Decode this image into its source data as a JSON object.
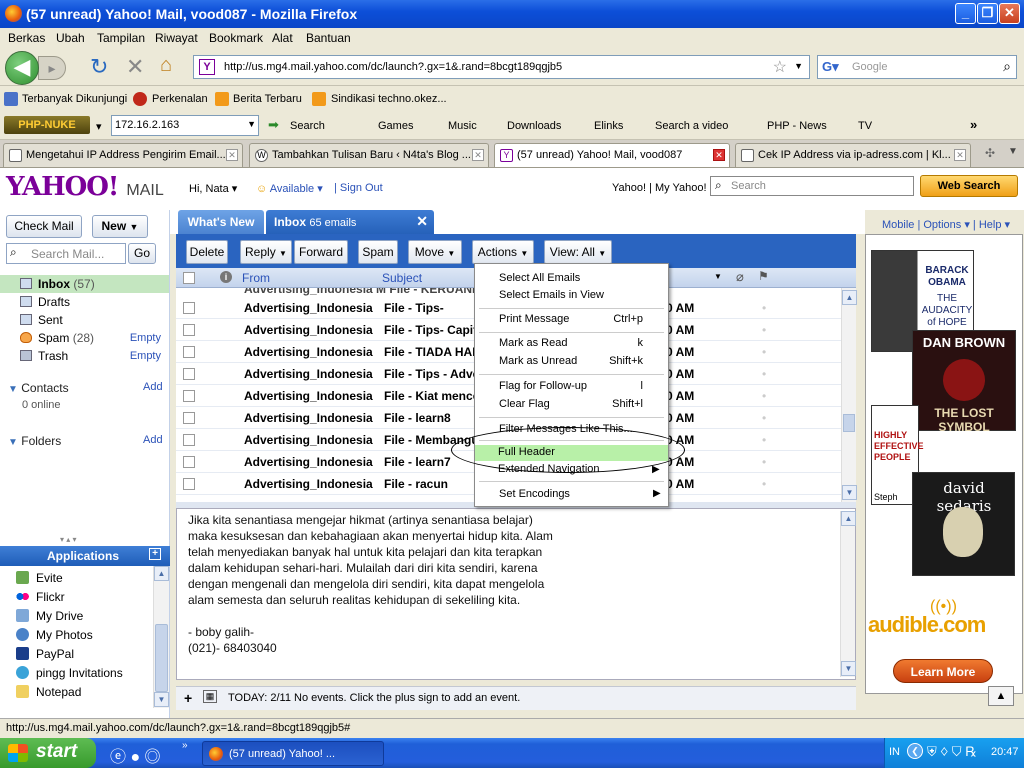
{
  "window": {
    "title": "(57 unread) Yahoo! Mail, vood087 - Mozilla Firefox"
  },
  "menubar": [
    "Berkas",
    "Ubah",
    "Tampilan",
    "Riwayat",
    "Bookmark",
    "Alat",
    "Bantuan"
  ],
  "nav": {
    "url": "http://us.mg4.mail.yahoo.com/dc/launch?.gx=1&.rand=8bcgt189qgjb5",
    "search_placeholder": "Google"
  },
  "bookmarks": [
    "Terbanyak Dikunjungi",
    "Perkenalan",
    "Berita Terbaru",
    "Sindikasi techno.okez..."
  ],
  "toolbar2": {
    "brand": "PHP-NUKE",
    "ip": "172.16.2.163",
    "items": [
      "Search",
      "Games",
      "Music",
      "Downloads",
      "Elinks",
      "Search a video",
      "PHP - News",
      "TV"
    ],
    "more": "»"
  },
  "tabs": [
    {
      "label": "Mengetahui IP Address Pengirim Email..."
    },
    {
      "label": "Tambahkan Tulisan Baru ‹ N4ta's Blog ..."
    },
    {
      "label": "(57 unread) Yahoo! Mail, vood087"
    },
    {
      "label": "Cek IP Address via ip-adress.com | Kl..."
    }
  ],
  "yahoo": {
    "logo": "YAHOO!",
    "logo_suffix": "MAIL",
    "greeting": "Hi, Nata",
    "status": "Available",
    "signout": "Sign Out",
    "links": "Yahoo! | My Yahoo!",
    "search_placeholder": "Search",
    "websearch": "Web Search",
    "toplinks": "Mobile | Options ▾ | Help ▾"
  },
  "sidebar": {
    "check_mail": "Check Mail",
    "new": "New",
    "search_placeholder": "Search Mail...",
    "go": "Go",
    "folders": [
      {
        "name": "Inbox",
        "count": "(57)",
        "empty": ""
      },
      {
        "name": "Drafts",
        "count": "",
        "empty": ""
      },
      {
        "name": "Sent",
        "count": "",
        "empty": ""
      },
      {
        "name": "Spam",
        "count": "(28)",
        "empty": "Empty"
      },
      {
        "name": "Trash",
        "count": "",
        "empty": "Empty"
      }
    ],
    "contacts": "Contacts",
    "contacts_add": "Add",
    "contacts_online": "0 online",
    "folders_label": "Folders",
    "folders_add": "Add",
    "applications": "Applications",
    "apps": [
      "Evite",
      "Flickr",
      "My Drive",
      "My Photos",
      "PayPal",
      "pingg Invitations",
      "Notepad"
    ]
  },
  "main": {
    "tab_whatsnew": "What's New",
    "tab_inbox": "Inbox",
    "inbox_count": "65 emails",
    "buttons": [
      "Delete",
      "Reply",
      "Forward",
      "Spam",
      "Move",
      "Actions",
      "View: All"
    ],
    "col_from": "From",
    "col_subject": "Subject",
    "rows": [
      {
        "from": "Advertising_Indonesia M",
        "subject": "File - Tips-",
        "time": "0 AM"
      },
      {
        "from": "Advertising_Indonesia M",
        "subject": "File - Tips- Capit",
        "time": "0 AM"
      },
      {
        "from": "Advertising_Indonesia M",
        "subject": "File - TIADA HAR",
        "time": "0 AM"
      },
      {
        "from": "Advertising_Indonesia M",
        "subject": "File - Tips - Adve",
        "time": "0 AM"
      },
      {
        "from": "Advertising_Indonesia M",
        "subject": "File - Kiat mence",
        "time": "0 AM"
      },
      {
        "from": "Advertising_Indonesia M",
        "subject": "File - learn8",
        "time": "0 AM"
      },
      {
        "from": "Advertising_Indonesia M",
        "subject": "File - Membangu",
        "time": "0 AM"
      },
      {
        "from": "Advertising_Indonesia M",
        "subject": "File - learn7",
        "time": "0 AM"
      },
      {
        "from": "Advertising_Indonesia M",
        "subject": "File - racun",
        "time": "0 AM"
      }
    ],
    "preview": [
      "Jika kita senantiasa mengejar hikmat (artinya senantiasa belajar)",
      "maka kesuksesan dan kebahagiaan akan menyertai hidup kita. Alam",
      "telah menyediakan banyak hal untuk kita pelajari dan kita terapkan",
      "dalam kehidupan sehari-hari. Mulailah dari diri kita sendiri, karena",
      "dengan mengenali dan mengelola diri sendiri, kita dapat mengelola",
      "alam semesta dan seluruh realitas kehidupan di sekeliling kita.",
      "",
      "- boby galih-",
      "(021)- 68403040"
    ],
    "calendar": "TODAY: 2/11   No events. Click the plus sign to add an event."
  },
  "actions_menu": [
    {
      "label": "Select All Emails",
      "key": ""
    },
    {
      "label": "Select Emails in View",
      "key": ""
    },
    {
      "label": "Print Message",
      "key": "Ctrl+p"
    },
    {
      "label": "Mark as Read",
      "key": "k"
    },
    {
      "label": "Mark as Unread",
      "key": "Shift+k"
    },
    {
      "label": "Flag for Follow-up",
      "key": "l"
    },
    {
      "label": "Clear Flag",
      "key": "Shift+l"
    },
    {
      "label": "Filter Messages Like This...",
      "key": ""
    },
    {
      "label": "Full Header",
      "key": ""
    },
    {
      "label": "Extended Navigation",
      "key": ""
    },
    {
      "label": "Set Encodings",
      "key": ""
    }
  ],
  "ad": {
    "book1_title": "BARACK OBAMA",
    "book1_sub": "THE AUDACITY of HOPE",
    "book2_title": "DAN BROWN",
    "book2_sub": "THE LOST SYMBOL",
    "book3_title": "HIGHLY EFFECTIVE PEOPLE",
    "book3_author": "Steph",
    "book4_title": "david sedaris",
    "brand": "audible.com",
    "cta": "Learn More"
  },
  "statusbar": "http://us.mg4.mail.yahoo.com/dc/launch?.gx=1&.rand=8bcgt189qgjb5#",
  "taskbar": {
    "start": "start",
    "item": "(57 unread) Yahoo! ...",
    "lang": "IN",
    "time": "20:47"
  },
  "colors": {
    "accent": "#2a64c0",
    "yahoo_purple": "#7b0099",
    "highlight": "#b8f0a8"
  }
}
